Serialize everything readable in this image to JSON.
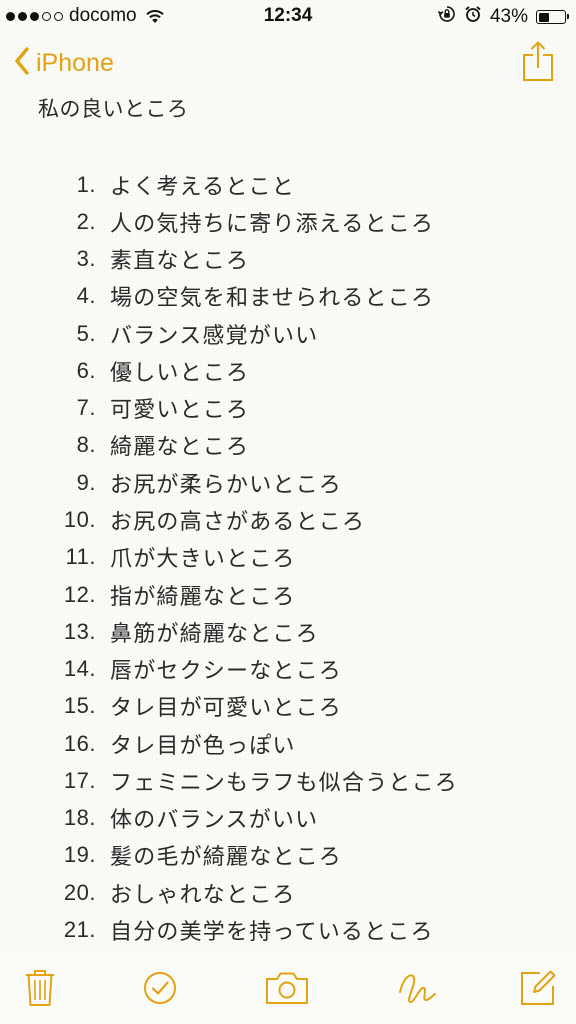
{
  "status_bar": {
    "carrier": "docomo",
    "time": "12:34",
    "battery_percent": "43%",
    "battery_level": 0.43,
    "signal_bars_filled": 3,
    "signal_bars_total": 5,
    "icons": [
      "wifi-icon",
      "orientation-lock-icon",
      "alarm-icon",
      "battery-icon"
    ]
  },
  "nav": {
    "back_label": "iPhone",
    "back_icon": "chevron-left-icon",
    "share_icon": "share-icon"
  },
  "note": {
    "title": "私の良いところ",
    "items": [
      {
        "num": "1.",
        "text": "よく考えるとこと"
      },
      {
        "num": "2.",
        "text": "人の気持ちに寄り添えるところ"
      },
      {
        "num": "3.",
        "text": "素直なところ"
      },
      {
        "num": "4.",
        "text": "場の空気を和ませられるところ"
      },
      {
        "num": "5.",
        "text": "バランス感覚がいい"
      },
      {
        "num": "6.",
        "text": "優しいところ"
      },
      {
        "num": "7.",
        "text": "可愛いところ"
      },
      {
        "num": "8.",
        "text": "綺麗なところ"
      },
      {
        "num": "9.",
        "text": "お尻が柔らかいところ"
      },
      {
        "num": "10.",
        "text": "お尻の高さがあるところ"
      },
      {
        "num": "11.",
        "text": "爪が大きいところ"
      },
      {
        "num": "12.",
        "text": "指が綺麗なところ"
      },
      {
        "num": "13.",
        "text": "鼻筋が綺麗なところ"
      },
      {
        "num": "14.",
        "text": "唇がセクシーなところ"
      },
      {
        "num": "15.",
        "text": "タレ目が可愛いところ"
      },
      {
        "num": "16.",
        "text": "タレ目が色っぽい"
      },
      {
        "num": "17.",
        "text": "フェミニンもラフも似合うところ"
      },
      {
        "num": "18.",
        "text": "体のバランスがいい"
      },
      {
        "num": "19.",
        "text": "髪の毛が綺麗なところ"
      },
      {
        "num": "20.",
        "text": "おしゃれなところ"
      },
      {
        "num": "21.",
        "text": "自分の美学を持っているところ"
      }
    ]
  },
  "toolbar": {
    "buttons": [
      "trash-icon",
      "checklist-icon",
      "camera-icon",
      "sketch-icon",
      "compose-icon"
    ]
  },
  "colors": {
    "accent": "#e2a214",
    "text": "#2a2a2a",
    "background": "#fbfbf8"
  }
}
